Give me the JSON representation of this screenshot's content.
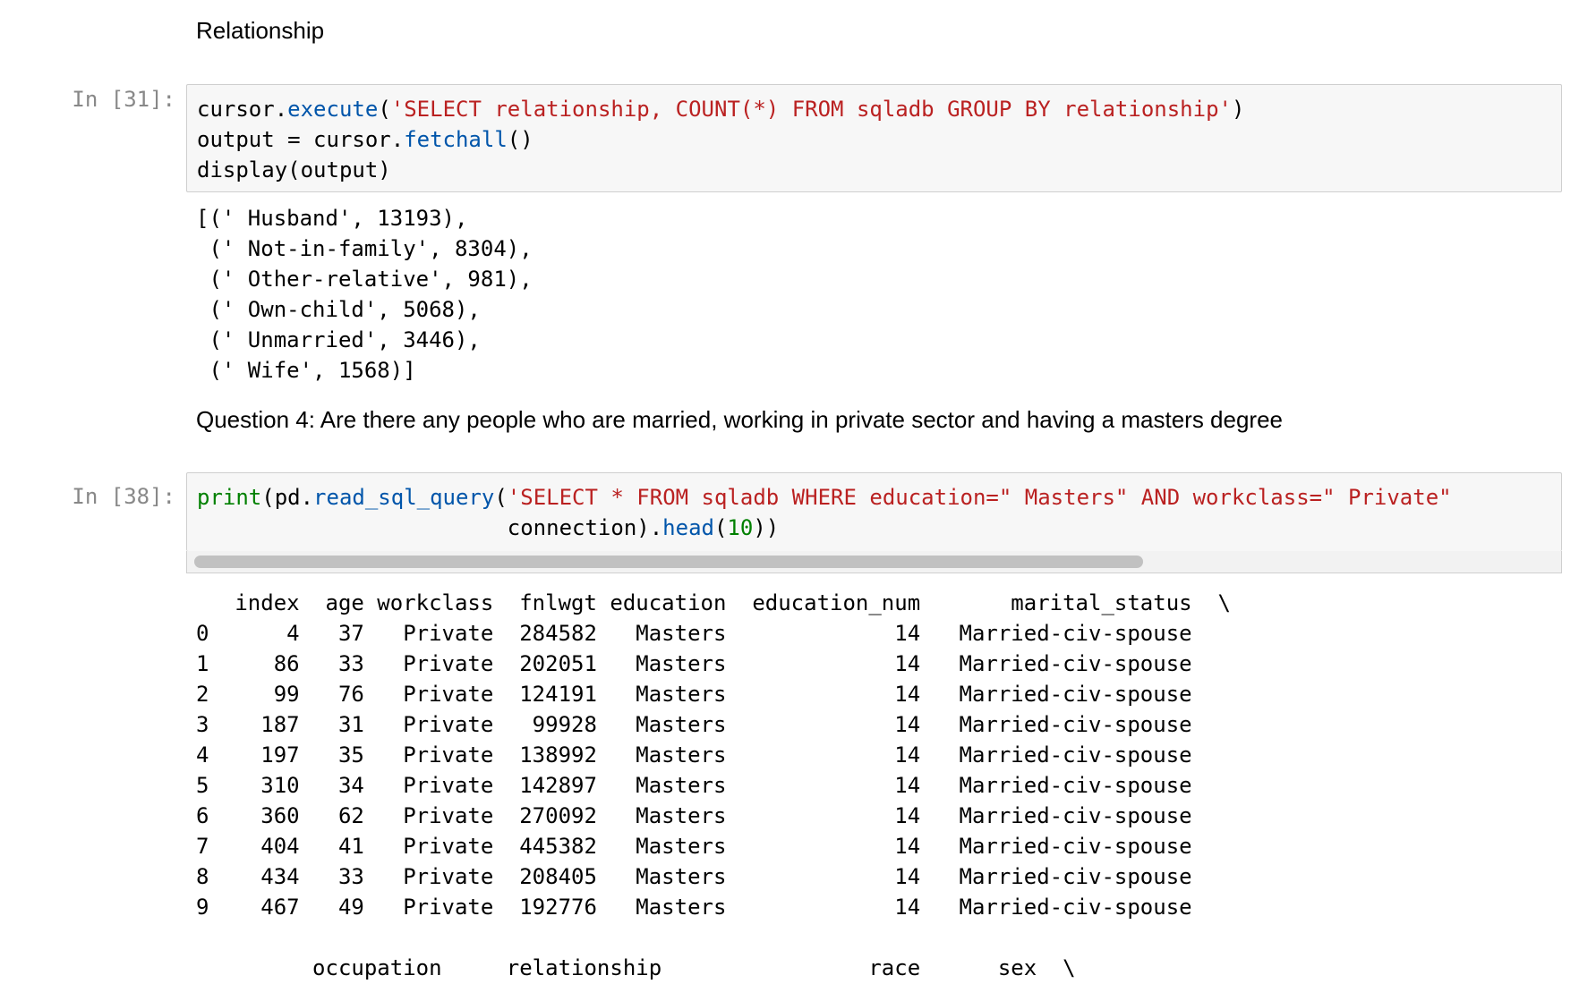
{
  "cells": {
    "md1": {
      "text": "Relationship"
    },
    "cell31": {
      "prompt": "In [31]:",
      "code_lines": [
        [
          {
            "t": "cursor.",
            "c": ""
          },
          {
            "t": "execute",
            "c": "fn"
          },
          {
            "t": "(",
            "c": ""
          },
          {
            "t": "'SELECT relationship, COUNT(*) FROM sqladb GROUP BY relationship'",
            "c": "str"
          },
          {
            "t": ")",
            "c": ""
          }
        ],
        [
          {
            "t": "output = cursor.",
            "c": ""
          },
          {
            "t": "fetchall",
            "c": "fn"
          },
          {
            "t": "()",
            "c": ""
          }
        ],
        [
          {
            "t": "display(output)",
            "c": ""
          }
        ]
      ],
      "output_lines": [
        "[(' Husband', 13193),",
        " (' Not-in-family', 8304),",
        " (' Other-relative', 981),",
        " (' Own-child', 5068),",
        " (' Unmarried', 3446),",
        " (' Wife', 1568)]"
      ]
    },
    "md2": {
      "text": "Question 4: Are there any people who are married, working in private sector and having a masters degree"
    },
    "cell38": {
      "prompt": "In [38]:",
      "code_lines": [
        [
          {
            "t": "print",
            "c": "kw-builtin"
          },
          {
            "t": "(pd.",
            "c": ""
          },
          {
            "t": "read_sql_query",
            "c": "fn"
          },
          {
            "t": "(",
            "c": ""
          },
          {
            "t": "'SELECT * FROM sqladb WHERE education=\" Masters\" AND workclass=\" Private\"",
            "c": "str"
          }
        ],
        [
          {
            "t": "                        connection).",
            "c": ""
          },
          {
            "t": "head",
            "c": "fn"
          },
          {
            "t": "(",
            "c": ""
          },
          {
            "t": "10",
            "c": "num"
          },
          {
            "t": "))",
            "c": ""
          }
        ]
      ],
      "output_lines": [
        "   index  age workclass  fnlwgt education  education_num       marital_status  \\",
        "0      4   37   Private  284582   Masters             14   Married-civ-spouse",
        "1     86   33   Private  202051   Masters             14   Married-civ-spouse",
        "2     99   76   Private  124191   Masters             14   Married-civ-spouse",
        "3    187   31   Private   99928   Masters             14   Married-civ-spouse",
        "4    197   35   Private  138992   Masters             14   Married-civ-spouse",
        "5    310   34   Private  142897   Masters             14   Married-civ-spouse",
        "6    360   62   Private  270092   Masters             14   Married-civ-spouse",
        "7    404   41   Private  445382   Masters             14   Married-civ-spouse",
        "8    434   33   Private  208405   Masters             14   Married-civ-spouse",
        "9    467   49   Private  192776   Masters             14   Married-civ-spouse",
        "",
        "         occupation     relationship                race      sex  \\"
      ]
    }
  },
  "colors": {
    "string": "#ba2121",
    "function": "#0055aa",
    "builtin": "#008000",
    "number": "#008000",
    "prompt": "#888888",
    "input_bg": "#f7f7f7"
  }
}
